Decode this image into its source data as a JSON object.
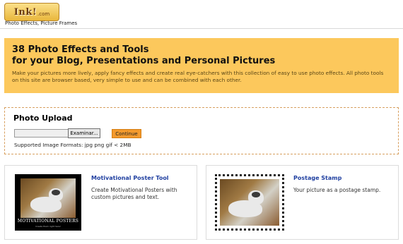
{
  "header": {
    "logo_text": "Ink!",
    "logo_suffix": ".com",
    "tagline": "Photo Effects, Picture Frames"
  },
  "banner": {
    "title_line1": "38 Photo Effects and Tools",
    "title_line2": "for your Blog, Presentations and Personal Pictures",
    "description": "Make your pictures more lively, apply fancy effects and create real eye-catchers with this collection of easy to use photo effects. All photo tools on this site are browser based, very simple to use and can be combined with each other."
  },
  "upload": {
    "title": "Photo Upload",
    "browse_label": "Examinar...",
    "continue_label": "Continue",
    "formats": "Supported Image Formats: jpg png gif < 2MB"
  },
  "cards": [
    {
      "title": "Motivational Poster Tool",
      "description": "Create Motivational Posters with custom pictures and text.",
      "poster_text": "MOTIVATIONAL POSTERS",
      "poster_subtext": "Create them right here!"
    },
    {
      "title": "Postage Stamp",
      "description": "Your picture as a postage stamp."
    }
  ],
  "colors": {
    "banner_bg": "#fcc85c",
    "link": "#1f3fa0",
    "continue_button": "#f39a2e"
  }
}
